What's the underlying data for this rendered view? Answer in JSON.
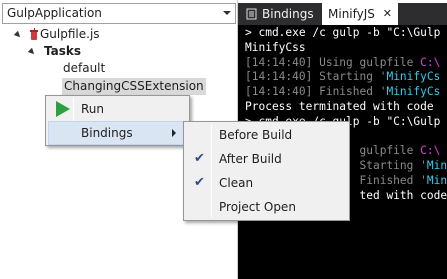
{
  "project_selector": {
    "value": "GulpApplication"
  },
  "tree": {
    "gulpfile": "Gulpfile.js",
    "tasks_label": "Tasks",
    "tasks": [
      "default",
      "ChangingCSSExtension"
    ]
  },
  "tabs": {
    "bindings": "Bindings",
    "minify": "MinifyJS",
    "close_glyph": "✕"
  },
  "console": {
    "lines": [
      {
        "text": "> cmd.exe /c gulp -b \"C:\\Gulp",
        "style": ""
      },
      {
        "text": "MinifyCss",
        "style": ""
      },
      {
        "time": "[14:14:40]",
        "text": " Using gulpfile ",
        "accent": "C:\\",
        "accent_style": "magenta"
      },
      {
        "time": "[14:14:40]",
        "text": " Starting '",
        "accent": "MinifyCs",
        "accent_style": "cyan"
      },
      {
        "time": "[14:14:40]",
        "text": " Finished '",
        "accent": "MinifyCs",
        "accent_style": "cyan"
      },
      {
        "text": "Process terminated with code",
        "style": ""
      },
      {
        "text": "> cmd.exe /c gulp -b \"C:\\Gulp",
        "style": ""
      },
      {
        "text": "",
        "style": ""
      },
      {
        "time": "",
        "text": "                 gulpfile ",
        "accent": "C:\\",
        "accent_style": "magenta"
      },
      {
        "time": "",
        "text": "                 Starting '",
        "accent": "MinifyJS",
        "accent_style": "cyan"
      },
      {
        "time": "",
        "text": "                 Finished '",
        "accent": "MinifyJS",
        "accent_style": "cyan"
      },
      {
        "text": "                 ted with code",
        "style": ""
      }
    ]
  },
  "context_menu": {
    "run": "Run",
    "bindings": "Bindings"
  },
  "bindings_submenu": {
    "items": [
      {
        "label": "Before Build",
        "checked": false
      },
      {
        "label": "After Build",
        "checked": true
      },
      {
        "label": "Clean",
        "checked": true
      },
      {
        "label": "Project Open",
        "checked": false
      }
    ],
    "check_glyph": "✔"
  },
  "colors": {
    "console_bg": "#000000",
    "tab_strip_bg": "#2d2d30",
    "menu_bg": "#f0f0f0",
    "menu_highlight": "#dae5f3",
    "run_icon": "#2e9e3e",
    "check": "#2a4f8a"
  }
}
